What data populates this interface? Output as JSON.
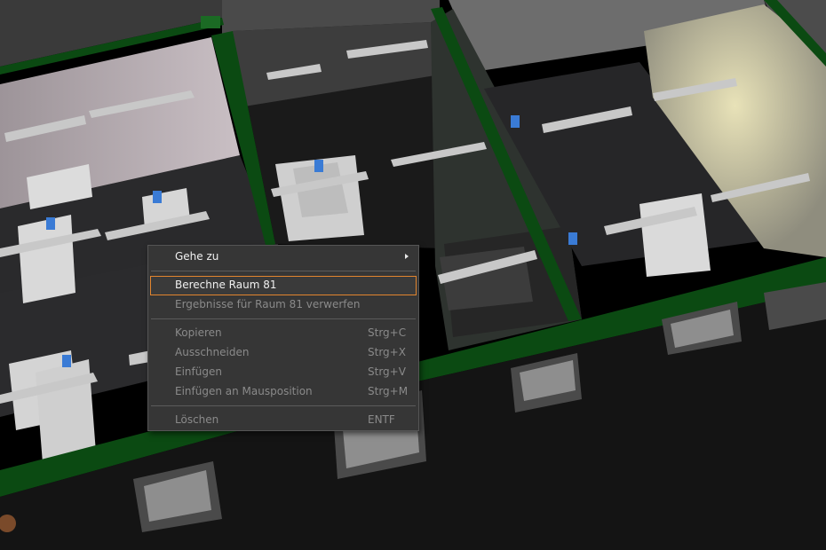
{
  "context_menu": {
    "goto": {
      "label": "Gehe zu",
      "has_submenu": true
    },
    "calculate": {
      "label": "Berechne Raum 81"
    },
    "discard": {
      "label": "Ergebnisse für Raum 81 verwerfen"
    },
    "copy": {
      "label": "Kopieren",
      "shortcut": "Strg+C"
    },
    "cut": {
      "label": "Ausschneiden",
      "shortcut": "Strg+X"
    },
    "paste": {
      "label": "Einfügen",
      "shortcut": "Strg+V"
    },
    "paste_at_mouse": {
      "label": "Einfügen an Mausposition",
      "shortcut": "Strg+M"
    },
    "delete": {
      "label": "Löschen",
      "shortcut": "ENTF"
    }
  },
  "colors": {
    "menu_background": "#363636",
    "highlight_border": "#e2852e",
    "disabled_text": "#8a8a8a",
    "wall_green": "#0b4a12"
  }
}
